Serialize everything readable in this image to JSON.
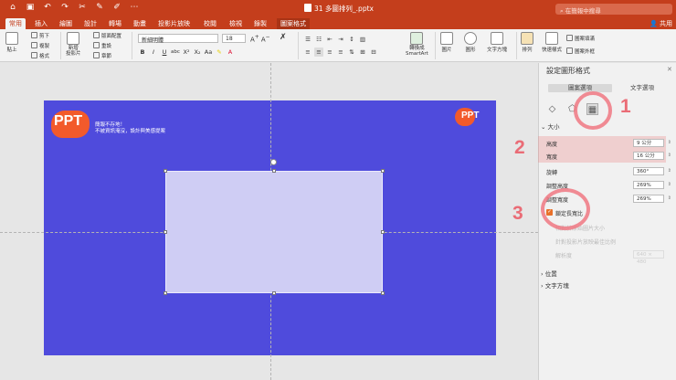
{
  "app": {
    "document_title": "31 多圖排列_.pptx",
    "search_placeholder": "在簡報中搜尋",
    "share_label": "共用"
  },
  "tabs": [
    {
      "label": "常用",
      "active": true
    },
    {
      "label": "插入"
    },
    {
      "label": "繪圖"
    },
    {
      "label": "設計"
    },
    {
      "label": "轉場"
    },
    {
      "label": "動畫"
    },
    {
      "label": "投影片放映"
    },
    {
      "label": "校閱"
    },
    {
      "label": "檢視"
    },
    {
      "label": "錄製"
    },
    {
      "label": "圖案格式",
      "accent": true
    }
  ],
  "ribbon": {
    "paste": "貼上",
    "cut": "剪下",
    "copy": "複製",
    "format": "格式",
    "new_slide": "新增\n投影片",
    "layout": "版面配置",
    "reset": "重設",
    "section": "章節",
    "font_name": "新細明體",
    "font_size": "18",
    "convert_smartart": "轉換成\nSmartArt",
    "picture": "圖片",
    "shapes": "圖形",
    "textbox": "文字方塊",
    "arrange": "排列",
    "quick_styles": "快速樣式",
    "shape_fill": "圖案填滿",
    "shape_outline": "圖案外框"
  },
  "slide": {
    "logo_text": "PPT",
    "tagline_1": "簡報不存地！",
    "tagline_2": "不被資訊淹沒，設計與美感提案",
    "corner_logo_text": "PPT"
  },
  "pane": {
    "title": "設定圖形格式",
    "close": "✕",
    "tab_shape": "圖案選項",
    "tab_text": "文字選項",
    "section_size": "大小",
    "height_label": "高度",
    "height_value": "9 公分",
    "width_label": "寬度",
    "width_value": "16 公分",
    "rotation_label": "旋轉",
    "rotation_value": "360°",
    "scale_h_label": "調整高度",
    "scale_h_value": "269%",
    "scale_w_label": "調整寬度",
    "scale_w_value": "269%",
    "lock_ratio_label": "鎖定長寬比",
    "relative_label": "相對於原始圖片大小",
    "best_scale_label": "針對投影片放映最佳比例",
    "resolution_label": "解析度",
    "resolution_value": "640 × 480",
    "section_position": "位置",
    "section_textbox": "文字方塊"
  },
  "annotations": {
    "n1": "1",
    "n2": "2",
    "n3": "3"
  },
  "colors": {
    "brand": "#c43e1c",
    "slide_bg": "#4f4bdc",
    "annotation": "#ea6c76"
  }
}
